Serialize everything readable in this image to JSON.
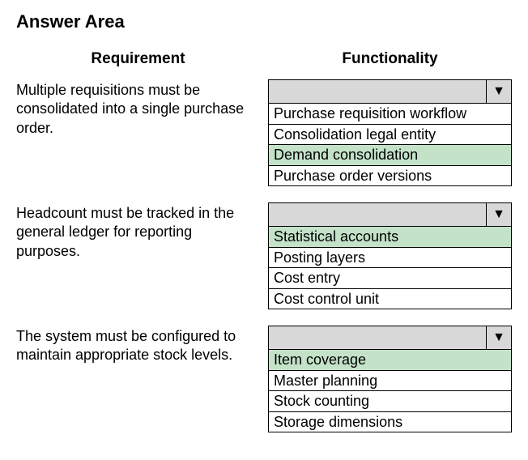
{
  "title": "Answer Area",
  "headers": {
    "left": "Requirement",
    "right": "Functionality"
  },
  "rows": [
    {
      "requirement": "Multiple requisitions must be consolidated into a single purchase order.",
      "options": [
        {
          "label": "Purchase requisition workflow",
          "selected": false
        },
        {
          "label": "Consolidation legal entity",
          "selected": false
        },
        {
          "label": "Demand consolidation",
          "selected": true
        },
        {
          "label": "Purchase order versions",
          "selected": false
        }
      ]
    },
    {
      "requirement": "Headcount must be tracked in the general ledger for reporting purposes.",
      "options": [
        {
          "label": "Statistical accounts",
          "selected": true
        },
        {
          "label": "Posting layers",
          "selected": false
        },
        {
          "label": "Cost entry",
          "selected": false
        },
        {
          "label": "Cost control unit",
          "selected": false
        }
      ]
    },
    {
      "requirement": "The system must be configured to maintain appropriate stock levels.",
      "options": [
        {
          "label": "Item coverage",
          "selected": true
        },
        {
          "label": "Master planning",
          "selected": false
        },
        {
          "label": "Stock counting",
          "selected": false
        },
        {
          "label": "Storage dimensions",
          "selected": false
        }
      ]
    }
  ]
}
